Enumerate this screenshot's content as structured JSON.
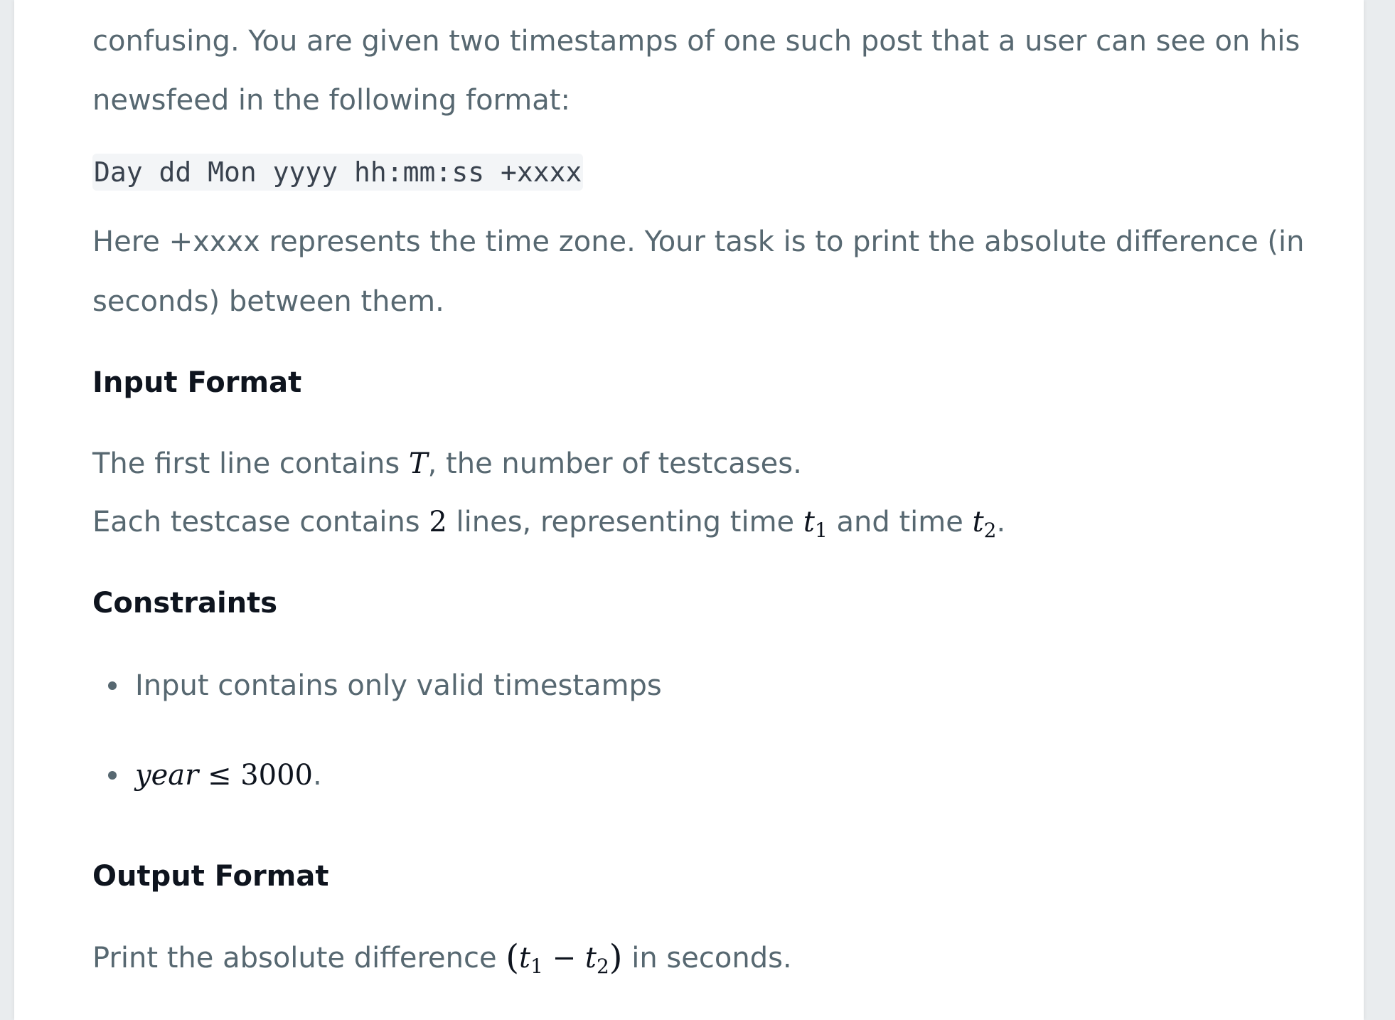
{
  "intro": {
    "line1": "confusing. You are given two timestamps of one such post that a user can see on his",
    "line2": "newsfeed in the following format:"
  },
  "format_code": "Day dd Mon yyyy hh:mm:ss +xxxx",
  "task": {
    "line1": "Here +xxxx represents the time zone. Your task is to print the absolute difference (in",
    "line2": "seconds) between them."
  },
  "input_format": {
    "heading": "Input Format",
    "line1_before": "The first line contains ",
    "line1_var": "T",
    "line1_after": ", the number of testcases.",
    "line2_before": "Each testcase contains ",
    "line2_num": "2",
    "line2_mid": " lines, representing time ",
    "t_var": "t",
    "sub1": "1",
    "line2_and": " and time ",
    "sub2": "2",
    "line2_end": "."
  },
  "constraints": {
    "heading": "Constraints",
    "item1": "Input contains only valid timestamps",
    "item2_var": "year",
    "item2_op": " ≤ 3000",
    "item2_end": "."
  },
  "output_format": {
    "heading": "Output Format",
    "before": "Print the absolute difference ",
    "open_paren": "(",
    "minus": " − ",
    "close_paren": ")",
    "after": " in seconds."
  }
}
